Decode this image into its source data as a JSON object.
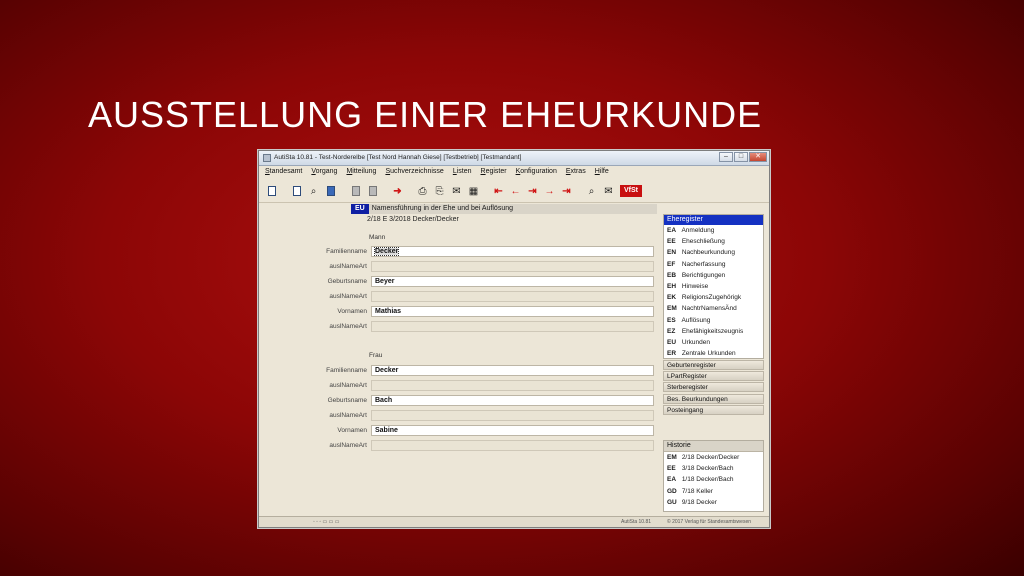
{
  "slide": {
    "title": "AUSSTELLUNG EINER EHEURKUNDE"
  },
  "window": {
    "title": "AutiSta 10.81 - Test-Norderelbe [Test Nord Hannah Giese] [Testbetrieb] [Testmandant]",
    "controls": {
      "minimize": "–",
      "maximize": "□",
      "close": "✕"
    }
  },
  "menu": [
    "Standesamt",
    "Vorgang",
    "Mitteilung",
    "Suchverzeichnisse",
    "Listen",
    "Register",
    "Konfiguration",
    "Extras",
    "Hilfe"
  ],
  "toolbar": {
    "icons": [
      "new-doc-icon",
      "copy-doc-icon",
      "search-doc-icon",
      "blue-doc-icon",
      "grey-doc-icon",
      "grey-docs-icon",
      "forward-icon",
      "print-icon",
      "print-preview-icon",
      "mail-icon",
      "calculator-icon",
      "arrow-first-icon",
      "arrow-prev-icon",
      "arrow-jump-icon",
      "arrow-next-icon",
      "arrow-last-icon",
      "search-icon",
      "inbox-icon",
      "vfst-logo-icon"
    ],
    "logo_label": "VfSt"
  },
  "form": {
    "code": "EU",
    "heading": "Namensführung in der Ehe und bei Auflösung",
    "subtitle": "2/18 E 3/2018 Decker/Decker",
    "mann": {
      "label": "Mann",
      "familienname_label": "Familienname",
      "familienname": "Decker",
      "ausl1_label": "auslNameArt",
      "geburtsname_label": "Geburtsname",
      "geburtsname": "Beyer",
      "ausl2_label": "auslNameArt",
      "vornamen_label": "Vornamen",
      "vornamen": "Mathias",
      "ausl3_label": "auslNameArt"
    },
    "frau": {
      "label": "Frau",
      "familienname_label": "Familienname",
      "familienname": "Decker",
      "ausl1_label": "auslNameArt",
      "geburtsname_label": "Geburtsname",
      "geburtsname": "Bach",
      "ausl2_label": "auslNameArt",
      "vornamen_label": "Vornamen",
      "vornamen": "Sabine",
      "ausl3_label": "auslNameArt"
    }
  },
  "eheregister": {
    "header": "Eheregister",
    "items": [
      {
        "code": "EA",
        "label": "Anmeldung"
      },
      {
        "code": "EE",
        "label": "Eheschließung"
      },
      {
        "code": "EN",
        "label": "Nachbeurkundung"
      },
      {
        "code": "EF",
        "label": "Nacherfassung"
      },
      {
        "code": "EB",
        "label": "Berichtigungen"
      },
      {
        "code": "EH",
        "label": "Hinweise"
      },
      {
        "code": "EK",
        "label": "ReligionsZugehörigk"
      },
      {
        "code": "EM",
        "label": "NachtrNamensÄnd"
      },
      {
        "code": "ES",
        "label": "Auflösung"
      },
      {
        "code": "EZ",
        "label": "Ehefähigkeitszeugnis"
      },
      {
        "code": "EU",
        "label": "Urkunden"
      },
      {
        "code": "ER",
        "label": "Zentrale Urkunden"
      }
    ]
  },
  "register_links": [
    "Geburtenregister",
    "LPartRegister",
    "Sterberegister",
    "Bes. Beurkundungen",
    "Posteingang"
  ],
  "historie": {
    "header": "Historie",
    "items": [
      {
        "code": "EM",
        "label": "2/18 Decker/Decker"
      },
      {
        "code": "EE",
        "label": "3/18 Decker/Bach"
      },
      {
        "code": "EA",
        "label": "1/18 Decker/Bach"
      },
      {
        "code": "GD",
        "label": "7/18 Keller"
      },
      {
        "code": "GU",
        "label": "9/18 Decker"
      }
    ]
  },
  "status": {
    "left": "◦ ◦ ◦ ▭ ▭ ▭",
    "version": "AutiSta 10.81",
    "copyright": "© 2017 Verlag für Standesamtswesen"
  }
}
